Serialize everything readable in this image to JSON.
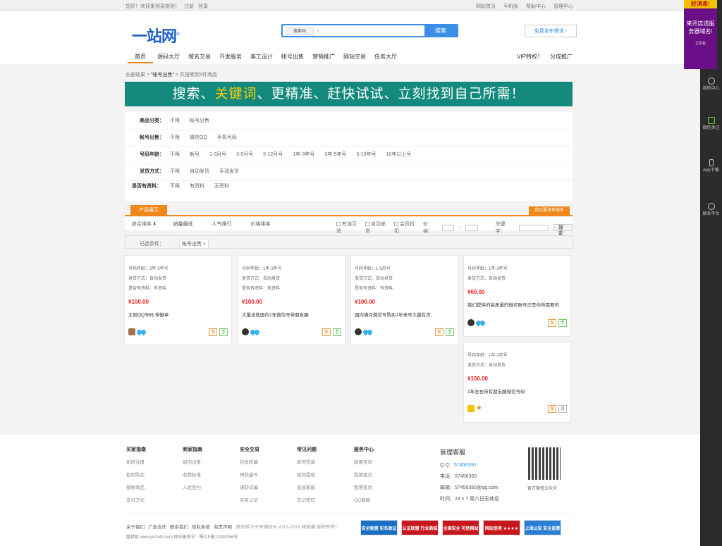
{
  "topbar": {
    "left": [
      "您好！欢迎来到易提验！",
      "注册",
      "登录"
    ],
    "right": [
      "网站首页",
      "手机版",
      "帮助中心",
      "管理中心"
    ]
  },
  "header": {
    "logo": "一站网",
    "search_type": "搜索码",
    "search_placeholder": "",
    "search_button": "搜索",
    "publish_button": "免费发布需求"
  },
  "nav": {
    "items": [
      "首页",
      "源码大厅",
      "域名交易",
      "开发服务",
      "美工设计",
      "帐号出售",
      "营销推广",
      "网站交易",
      "任务大厅"
    ],
    "right": [
      "VIP特权！",
      "分成推广"
    ]
  },
  "breadcrumb": {
    "root": "全部结果",
    "sep1": " > ",
    "cat": "\"帐号出售\"",
    "tail": " > 共搜索到5件商品"
  },
  "banner": {
    "p1": "搜索、",
    "hl": "关键词",
    "p2": "、更精准、赶快试试、立刻找到自己所需！"
  },
  "filters": [
    {
      "label": "商品分类：",
      "values": [
        "不限",
        "帐号出售"
      ]
    },
    {
      "label": "帐号出售：",
      "values": [
        "不限",
        "微信QQ",
        "手机号码"
      ]
    },
    {
      "label": "号码年龄：",
      "values": [
        "不限",
        "新号",
        "1-3月号",
        "3-5月号",
        "5-12月号",
        "1年-3年号",
        "3年-5年号",
        "5-10年号",
        "10年以上号"
      ]
    },
    {
      "label": "发货方式：",
      "values": [
        "不限",
        "自动发货",
        "手动发货"
      ]
    },
    {
      "label": "是否有资料：",
      "values": [
        "不限",
        "有资料",
        "无资料"
      ]
    }
  ],
  "tabs": {
    "active": "产品展示",
    "right": "我也要发布域名"
  },
  "sort": {
    "items": [
      "综合排序 ⬇",
      "销量最低",
      "人气排行",
      "价格排序"
    ],
    "opts": [
      "有演示站",
      "自动发货",
      "会员折扣"
    ],
    "price_label": "价格：",
    "keyword_label": "关键字：",
    "button": "搜索"
  },
  "selected": {
    "label": "已选条件：",
    "chip": "帐号出售 ×"
  },
  "cards": [
    {
      "lines": [
        "号码年龄：3年-5年号",
        "发货方式：自动发货",
        "是否有资料：有资料"
      ],
      "price": "¥100.00",
      "title": "太阳QQ号码 带徽章"
    },
    {
      "lines": [
        "号码年龄：1年-3年号",
        "发货方式：自动发货",
        "是否有资料：有资料"
      ],
      "price": "¥100.00",
      "title": "大量出售国内1年微信号带朋友圈"
    },
    {
      "lines": [
        "号码年龄：1-3月号",
        "发货方式：自动发货",
        "是否有资料：有资料"
      ],
      "price": "¥100.00",
      "title": "国内满月微信号购买1年老号大量有货"
    },
    {
      "lines": [
        "号码年龄：1年-3年号",
        "发货方式：自动发货"
      ],
      "price": "¥60.00",
      "title": "我们提供的高质量的微信账号正是你所需要的"
    },
    {
      "lines": [
        "号码年龄：1年-3年号",
        "发货方式：自动发货"
      ],
      "price": "¥100.00",
      "title": "1年左右带有朋友圈微信号码"
    }
  ],
  "card_badges": {
    "b1": "保",
    "b2": "手",
    "b3": "息"
  },
  "footer": {
    "cols": [
      {
        "h": "买家指南",
        "items": [
          "如何注册",
          "如何购买",
          "搜索商品",
          "支付方式"
        ]
      },
      {
        "h": "卖家指南",
        "items": [
          "如何出售",
          "收费标准",
          "入驻签约"
        ]
      },
      {
        "h": "安全交易",
        "items": [
          "钓鱼防骗",
          "预防盗号",
          "谨防诈骗",
          "实名认证"
        ]
      },
      {
        "h": "常见问题",
        "items": [
          "如何充值",
          "如何提现",
          "直接客服",
          "忘记密码"
        ]
      },
      {
        "h": "服务中心",
        "items": [
          "我要咨询",
          "我要建议",
          "我要投诉",
          "QQ客服"
        ]
      }
    ],
    "service": {
      "h": "管理客服",
      "qq_label": "Q Q：",
      "qq": "57456350",
      "tel": "电话：57456350",
      "mail": "邮箱：57456350@qq.com",
      "time": "时间：24 x 7 周六日无休息"
    },
    "qr_label": "官方微信公众号",
    "links": [
      "关于我们",
      "广告合作",
      "联系我们",
      "隐私条款",
      "免责声明"
    ],
    "notice": "原创势力千单铺站长 2013-2016 微微鑫 版权所有！",
    "icp": "趣猎板 www.yichafe.com 网站备案号：蜀ICP备12000056号",
    "badges": [
      "安全联盟 实名验证",
      "认证联盟 行业商城",
      "全国安全 可信网站",
      "网站信用 ★★★★",
      "上海公安 安全监督"
    ]
  },
  "promo": {
    "top": "好消息!",
    "text": "来开店送服务器域名!",
    "small": "立即看"
  },
  "sidebar": [
    "我的中心",
    "微信关注",
    "App下载",
    "联系平台"
  ],
  "colors": {
    "accent": "#f0871a",
    "brand": "#3a8ee6",
    "banner": "#148a7e",
    "price": "#e22222"
  }
}
